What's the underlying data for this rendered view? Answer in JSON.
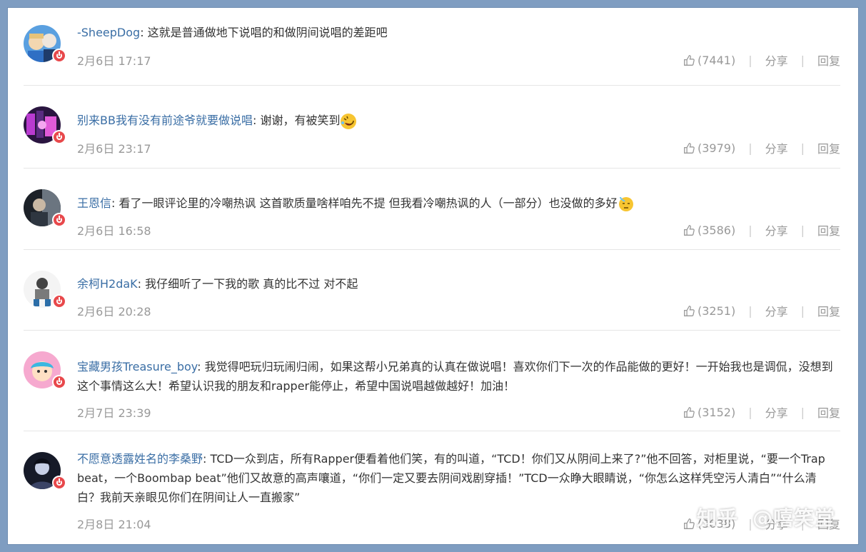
{
  "comments": [
    {
      "author": "-SheepDog",
      "separator": ":",
      "text": " 这就是普通做地下说唱的和做阴间说唱的差距吧",
      "date": "2月6日 17:17",
      "likes": "(7441)",
      "share_label": "分享",
      "reply_label": "回复",
      "avatar_colors": [
        "#4a8fd6",
        "#f3d7b0"
      ]
    },
    {
      "author": "别来BB我有没有前途爷就要做说唱",
      "separator": ":",
      "text": " 谢谢，有被笑到",
      "emoji": "rolling-on-floor-laughing-emoji",
      "date": "2月6日 23:17",
      "likes": "(3979)",
      "share_label": "分享",
      "reply_label": "回复",
      "avatar_colors": [
        "#3a1f5a",
        "#d94fd6"
      ]
    },
    {
      "author": "王恩信",
      "separator": ":",
      "text": " 看了一眼评论里的冷嘲热讽 这首歌质量啥样咱先不提 但我看冷嘲热讽的人（一部分）也没做的多好",
      "emoji": "sweat-face-emoji",
      "date": "2月6日 16:58",
      "likes": "(3586)",
      "share_label": "分享",
      "reply_label": "回复",
      "avatar_colors": [
        "#222831",
        "#9aa4ad"
      ]
    },
    {
      "author": "余柯H2daK",
      "separator": ":",
      "text": " 我仔细听了一下我的歌 真的比不过 对不起",
      "date": "2月6日 20:28",
      "likes": "(3251)",
      "share_label": "分享",
      "reply_label": "回复",
      "avatar_colors": [
        "#f2f2f2",
        "#444444"
      ]
    },
    {
      "author": "宝藏男孩Treasure_boy",
      "separator": ":",
      "text": " 我觉得吧玩归玩闹归闹，如果这帮小兄弟真的认真在做说唱！喜欢你们下一次的作品能做的更好！一开始我也是调侃，没想到这个事情这么大！希望认识我的朋友和rapper能停止，希望中国说唱越做越好！加油！",
      "date": "2月7日 23:39",
      "likes": "(3152)",
      "share_label": "分享",
      "reply_label": "回复",
      "avatar_colors": [
        "#f29ac6",
        "#59c3e6"
      ]
    },
    {
      "author": "不愿意透露姓名的李桑野",
      "separator": ":",
      "text": " TCD一众到店，所有Rapper便看着他们笑，有的叫道，“TCD！你们又从阴间上来了?”他不回答，对柜里说，“要一个Trap beat，一个Boombap beat”他们又故意的高声嚷道，“你们一定又要去阴间戏剧穿插！”TCD一众睁大眼睛说，“你怎么这样凭空污人清白”“什么清白？我前天亲眼见你们在阴间让人一直搬家”",
      "date": "2月8日 21:04",
      "likes": "(3038)",
      "share_label": "分享",
      "reply_label": "回复",
      "avatar_colors": [
        "#1b1e2e",
        "#b8c3e0"
      ]
    }
  ],
  "watermark": {
    "brand": "知乎",
    "handle": "@嘻笑堂"
  }
}
